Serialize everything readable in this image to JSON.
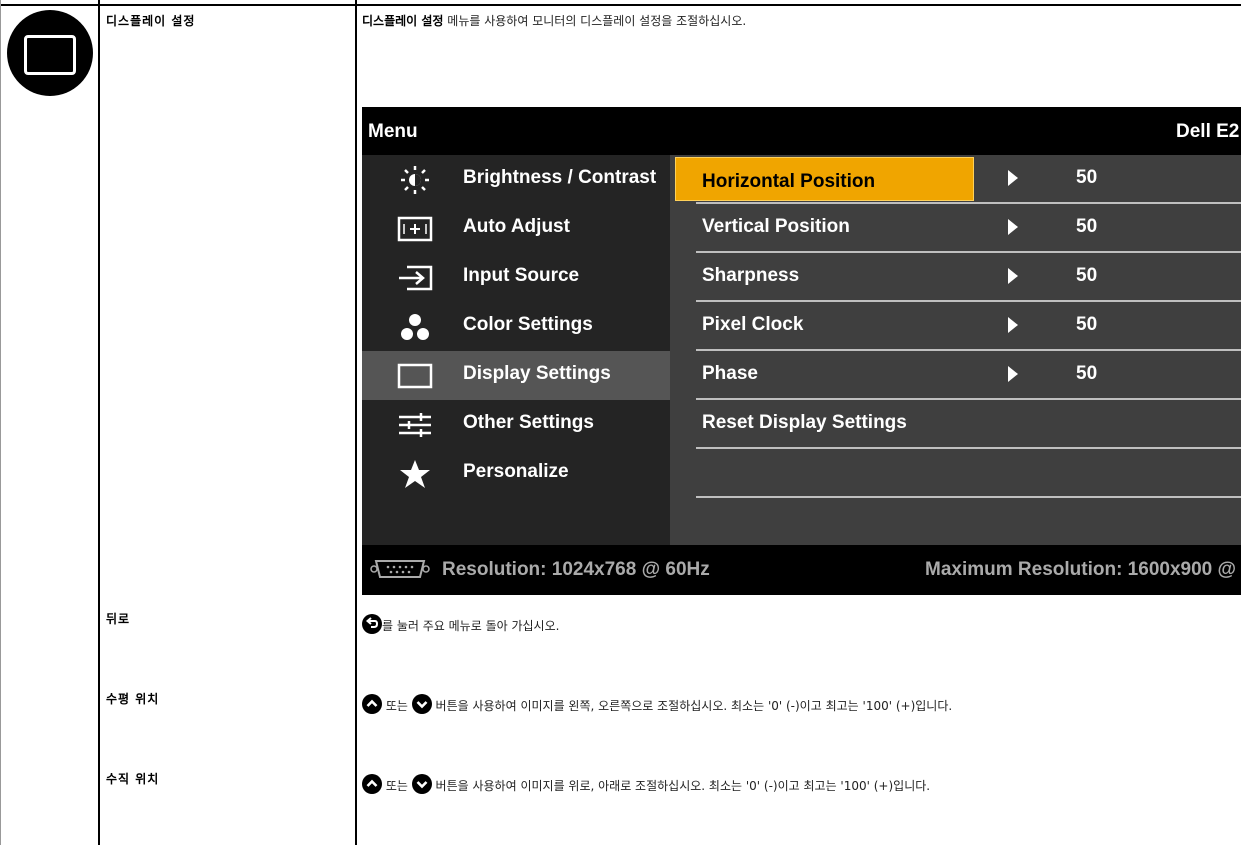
{
  "sections": [
    {
      "label": "디스플레이 설정",
      "description_bold": "디스플레이 설정",
      "description": " 메뉴를 사용하여 모니터의 디스플레이 설정을 조절하십시오."
    },
    {
      "label": "뒤로",
      "description": "를 눌러 주요 메뉴로 돌아 가십시오."
    },
    {
      "label": "수평 위치",
      "description_mid": " 또는 ",
      "description": " 버튼을 사용하여 이미지를 왼쪽, 오른쪽으로 조절하십시오. 최소는 '0' (-)이고 최고는 '100' (+)입니다."
    },
    {
      "label": "수직 위치",
      "description_mid": " 또는 ",
      "description": " 버튼을 사용하여 이미지를 위로, 아래로 조절하십시오. 최소는 '0' (-)이고 최고는 '100' (+)입니다."
    }
  ],
  "osd": {
    "title": "Menu",
    "model": "Dell E2",
    "menu_items": [
      {
        "label": "Brightness / Contrast",
        "icon": "brightness-icon"
      },
      {
        "label": "Auto Adjust",
        "icon": "auto-adjust-icon"
      },
      {
        "label": "Input Source",
        "icon": "input-source-icon"
      },
      {
        "label": "Color Settings",
        "icon": "color-settings-icon"
      },
      {
        "label": "Display Settings",
        "icon": "display-settings-icon",
        "selected": true
      },
      {
        "label": "Other Settings",
        "icon": "other-settings-icon"
      },
      {
        "label": "Personalize",
        "icon": "star-icon"
      }
    ],
    "submenu": [
      {
        "label": "Horizontal Position",
        "value": "50",
        "highlighted": true
      },
      {
        "label": "Vertical Position",
        "value": "50"
      },
      {
        "label": "Sharpness",
        "value": "50"
      },
      {
        "label": "Pixel Clock",
        "value": "50"
      },
      {
        "label": "Phase",
        "value": "50"
      },
      {
        "label": "Reset Display Settings",
        "value": ""
      },
      {
        "label": "",
        "value": ""
      }
    ],
    "resolution": "Resolution: 1024x768 @ 60Hz",
    "max_resolution": "Maximum Resolution: 1600x900 @"
  },
  "colors": {
    "highlight": "#f0a500",
    "osd_left": "#242424",
    "osd_right": "#3f3f3f",
    "osd_selected": "#555555"
  }
}
